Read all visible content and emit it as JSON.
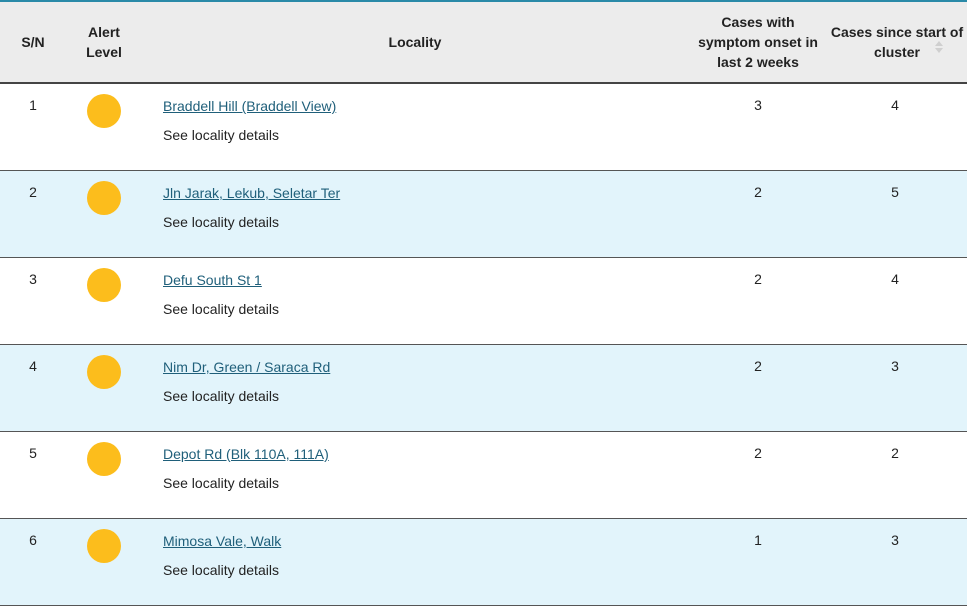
{
  "colors": {
    "header_bg": "#ececec",
    "alt_row_bg": "#e2f4fb",
    "alert_amber": "#fcbd1c",
    "link": "#1f5f7a",
    "top_border": "#2a8aa8"
  },
  "table": {
    "headers": {
      "sn": "S/N",
      "alert_level": "Alert Level",
      "locality": "Locality",
      "cases_2weeks": "Cases with symptom onset in last 2 weeks",
      "cases_since_start": "Cases since start of cluster",
      "sort_icon": "sort-icon"
    },
    "rows": [
      {
        "sn": "1",
        "alert": "amber",
        "locality": "Braddell Hill (Braddell View)",
        "details": "See locality details",
        "cases_2weeks": "3",
        "cases_since_start": "4"
      },
      {
        "sn": "2",
        "alert": "amber",
        "locality": "Jln Jarak, Lekub, Seletar Ter",
        "details": "See locality details",
        "cases_2weeks": "2",
        "cases_since_start": "5"
      },
      {
        "sn": "3",
        "alert": "amber",
        "locality": "Defu South St 1",
        "details": "See locality details",
        "cases_2weeks": "2",
        "cases_since_start": "4"
      },
      {
        "sn": "4",
        "alert": "amber",
        "locality": "Nim Dr, Green / Saraca Rd",
        "details": "See locality details",
        "cases_2weeks": "2",
        "cases_since_start": "3"
      },
      {
        "sn": "5",
        "alert": "amber",
        "locality": "Depot Rd (Blk 110A, 111A)",
        "details": "See locality details",
        "cases_2weeks": "2",
        "cases_since_start": "2"
      },
      {
        "sn": "6",
        "alert": "amber",
        "locality": "Mimosa Vale, Walk",
        "details": "See locality details",
        "cases_2weeks": "1",
        "cases_since_start": "3"
      }
    ]
  }
}
